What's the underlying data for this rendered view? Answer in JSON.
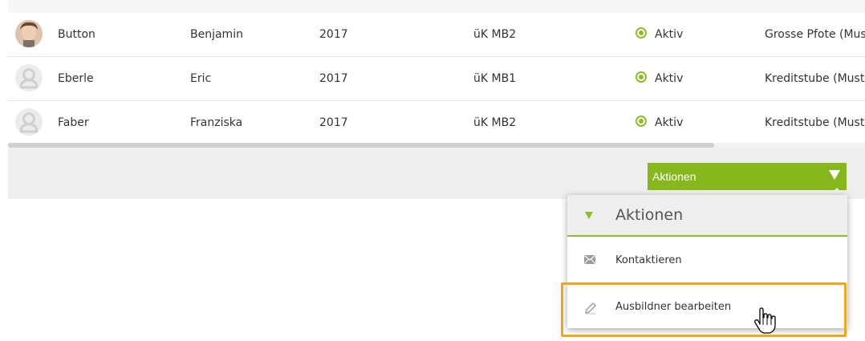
{
  "table": {
    "rows": [
      {
        "last_name": "Button",
        "first_name": "Benjamin",
        "year": "2017",
        "course": "üK MB2",
        "status": "Aktiv",
        "company": "Grosse Pfote (Must",
        "avatar": "photo"
      },
      {
        "last_name": "Eberle",
        "first_name": "Eric",
        "year": "2017",
        "course": "üK MB1",
        "status": "Aktiv",
        "company": "Kreditstube (Muste",
        "avatar": "placeholder-user-icon"
      },
      {
        "last_name": "Faber",
        "first_name": "Franziska",
        "year": "2017",
        "course": "üK MB2",
        "status": "Aktiv",
        "company": "Kreditstube (Muste",
        "avatar": "placeholder-user-icon"
      }
    ]
  },
  "actions": {
    "button_label": "Aktionen",
    "dropdown": {
      "title": "Aktionen",
      "items": [
        {
          "label": "Kontaktieren",
          "icon": "envelope-icon"
        },
        {
          "label": "Ausbildner bearbeiten",
          "icon": "pencil-icon"
        }
      ]
    }
  },
  "colors": {
    "accent_green": "#86b71d",
    "highlight_orange": "#f3a51c"
  }
}
